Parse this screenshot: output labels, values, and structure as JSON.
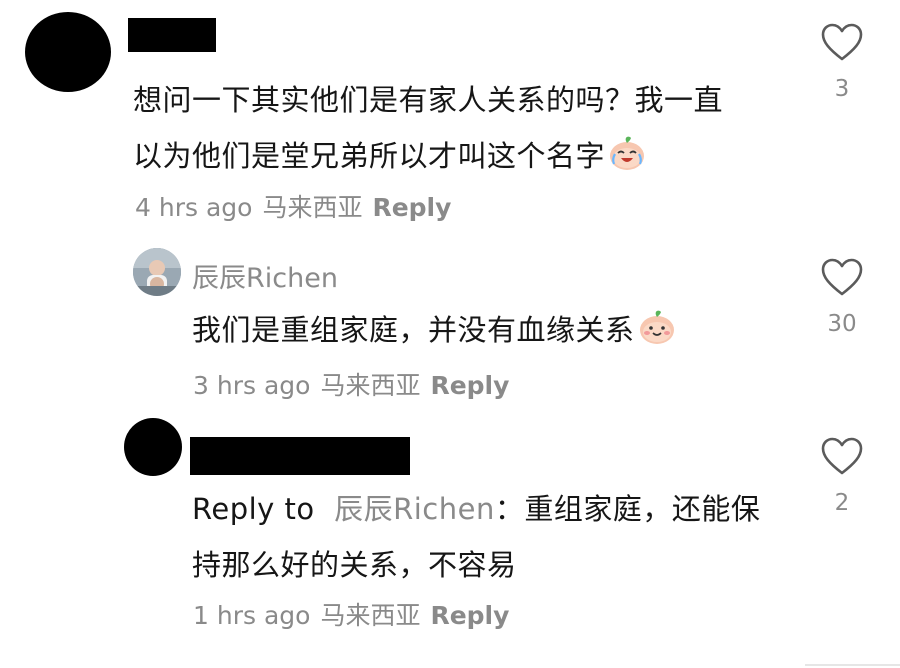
{
  "comments": [
    {
      "username_redacted": true,
      "text_lines": [
        "想问一下其实他们是有家人关系的吗？我一直",
        "以为他们是堂兄弟所以才叫这个名字"
      ],
      "emoji": "crying-laughing-peach-emoji",
      "time": "4 hrs ago",
      "location": "马来西亚",
      "reply_label": "Reply",
      "likes": "3"
    },
    {
      "username": "辰辰Richen",
      "text_lines": [
        "我们是重组家庭，并没有血缘关系"
      ],
      "emoji": "smiling-peach-emoji",
      "time": "3 hrs ago",
      "location": "马来西亚",
      "reply_label": "Reply",
      "likes": "30"
    },
    {
      "username_redacted": true,
      "reply_to_label": "Reply to",
      "reply_to_user": "辰辰Richen",
      "text_first": "：重组家庭，还能保",
      "text_second": "持那么好的关系，不容易",
      "time": "1 hrs ago",
      "location": "马来西亚",
      "reply_label": "Reply",
      "likes": "2"
    }
  ],
  "icons": {
    "like": "heart-outline-icon"
  },
  "colors": {
    "text": "#161616",
    "muted": "#8a8a8a"
  }
}
